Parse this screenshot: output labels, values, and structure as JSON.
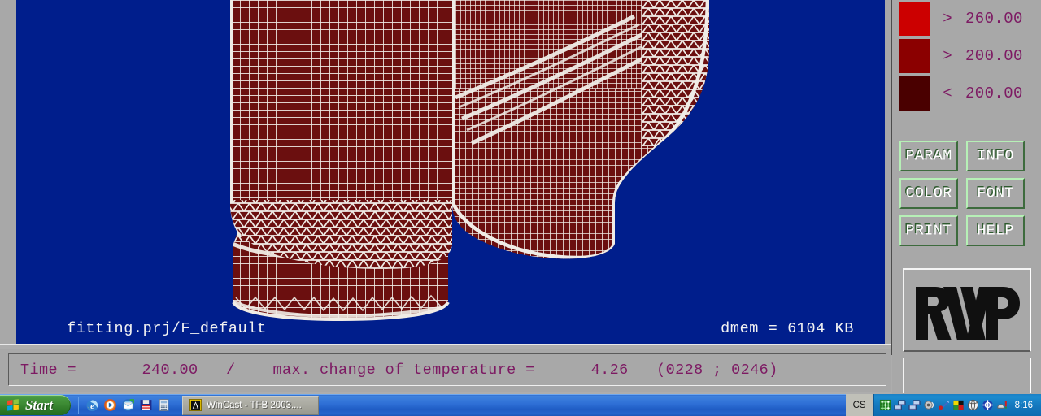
{
  "app": {
    "name": "WinCast",
    "viewport": {
      "background_color": "#001e8c",
      "mesh_line_color": "#f0ece6",
      "surface_color": "#6b0f0f",
      "project_label": "fitting.prj/F_default",
      "memory_label": "dmem = 6104 KB",
      "model_description": "casting-fitting-finite-element-mesh"
    },
    "statusbar": {
      "text": "Time =       240.00   /    max. change of temperature =      4.26   (0228 ; 0246)",
      "time_label": "Time =",
      "time_value": "240.00",
      "separator": "/",
      "metric_label": "max. change of temperature =",
      "metric_value": "4.26",
      "node_range": "(0228 ; 0246)",
      "text_color": "#7d1a63"
    },
    "legend": {
      "rows": [
        {
          "color": "#cc0000",
          "operator": ">",
          "value": "260.00"
        },
        {
          "color": "#8b0000",
          "operator": ">",
          "value": "200.00"
        },
        {
          "color": "#4a0000",
          "operator": "<",
          "value": "200.00"
        }
      ]
    },
    "buttons": [
      {
        "label": "PARAM",
        "name": "param-button"
      },
      {
        "label": "INFO",
        "name": "info-button"
      },
      {
        "label": "COLOR",
        "name": "color-button"
      },
      {
        "label": "FONT",
        "name": "font-button"
      },
      {
        "label": "PRINT",
        "name": "print-button"
      },
      {
        "label": "HELP",
        "name": "help-button"
      }
    ],
    "logo": {
      "text": "RWP",
      "color": "#101010"
    }
  },
  "taskbar": {
    "start_label": "Start",
    "quick_launch": [
      {
        "name": "internet-explorer-icon",
        "title": "Internet Explorer"
      },
      {
        "name": "media-player-icon",
        "title": "Windows Media Player"
      },
      {
        "name": "outlook-express-icon",
        "title": "Outlook Express"
      },
      {
        "name": "floppy-save-icon",
        "title": "Save"
      },
      {
        "name": "notepad-icon",
        "title": "Notepad"
      }
    ],
    "tasks": [
      {
        "label": "WinCast - TFB 2003....",
        "name": "taskbar-button-wincast"
      }
    ],
    "language_indicator": "CS",
    "tray_icons": [
      {
        "name": "network-activity-icon"
      },
      {
        "name": "network-connection-icon"
      },
      {
        "name": "network-connection-2-icon"
      },
      {
        "name": "volume-icon"
      },
      {
        "name": "pen-tool-icon"
      },
      {
        "name": "color-palette-icon"
      },
      {
        "name": "globe-icon"
      },
      {
        "name": "shield-globe-icon"
      },
      {
        "name": "printer-monitor-icon"
      }
    ],
    "clock": "8:16"
  }
}
